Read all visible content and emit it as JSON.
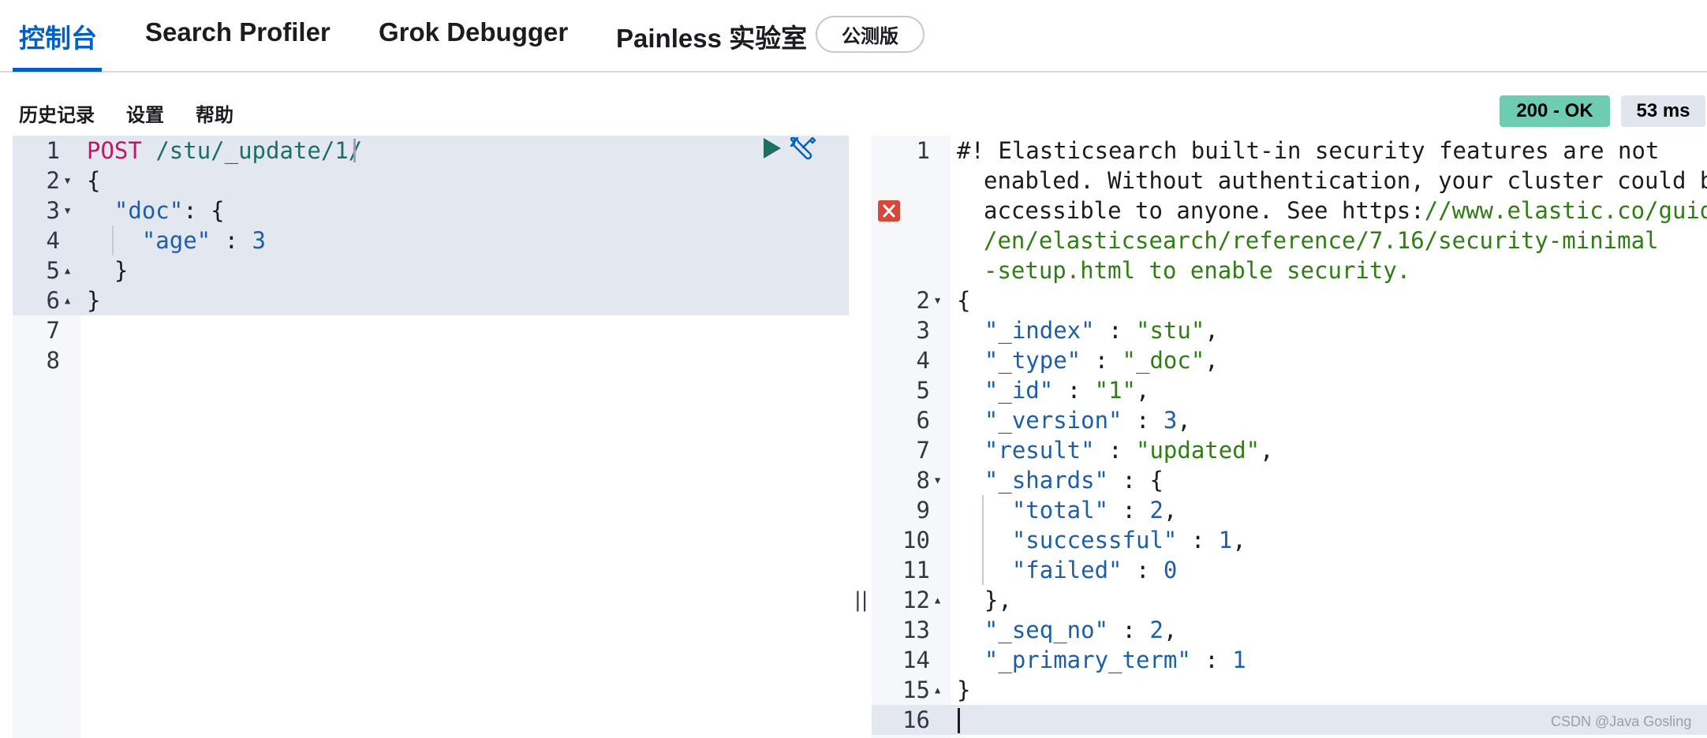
{
  "tabs": {
    "console": "控制台",
    "search_profiler": "Search Profiler",
    "grok_debugger": "Grok Debugger",
    "painless_lab": "Painless 实验室",
    "beta_badge": "公测版"
  },
  "toolbar": {
    "history": "历史记录",
    "settings": "设置",
    "help": "帮助",
    "status": "200 - OK",
    "duration": "53 ms"
  },
  "request": {
    "line_numbers": [
      "1",
      "2",
      "3",
      "4",
      "5",
      "6",
      "7",
      "8"
    ],
    "method": "POST",
    "url": "/stu/_update/1/",
    "l2": "{",
    "l3_key": "\"doc\"",
    "l3_rest": ": {",
    "l4_key": "\"age\"",
    "l4_sep": " : ",
    "l4_val": "3",
    "l5": "}",
    "l6": "}"
  },
  "response": {
    "line_numbers": [
      "1",
      "2",
      "3",
      "4",
      "5",
      "6",
      "7",
      "8",
      "9",
      "10",
      "11",
      "12",
      "13",
      "14",
      "15",
      "16"
    ],
    "warning_1": "#! Elasticsearch built-in security features are not",
    "warning_2": "enabled. Without authentication, your cluster could be",
    "warning_3a": "accessible to anyone. See https:",
    "warning_3b": "//www.elastic.co/guide",
    "warning_4": "/en/elasticsearch/reference/7.16/security-minimal",
    "warning_5": "-setup.html to enable security.",
    "open_brace": "{",
    "index_key": "\"_index\"",
    "index_val": "\"stu\"",
    "type_key": "\"_type\"",
    "type_val": "\"_doc\"",
    "id_key": "\"_id\"",
    "id_val": "\"1\"",
    "version_key": "\"_version\"",
    "version_val": "3",
    "result_key": "\"result\"",
    "result_val": "\"updated\"",
    "shards_key": "\"_shards\"",
    "total_key": "\"total\"",
    "total_val": "2",
    "successful_key": "\"successful\"",
    "successful_val": "1",
    "failed_key": "\"failed\"",
    "failed_val": "0",
    "shards_close": "},",
    "seq_key": "\"_seq_no\"",
    "seq_val": "2",
    "term_key": "\"_primary_term\"",
    "term_val": "1",
    "close_brace": "}"
  },
  "icons": {
    "run": "play-icon",
    "settings": "wrench-icon",
    "error": "error-icon",
    "resize": "resize-handle-icon"
  },
  "colors": {
    "accent": "#0061c2",
    "status_ok": "#6dccb1",
    "method": "#bd1966",
    "string": "#2f7d14",
    "number": "#1e5ea8"
  },
  "watermark": "CSDN @Java Gosling"
}
